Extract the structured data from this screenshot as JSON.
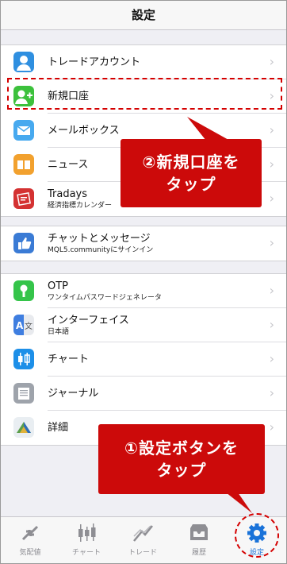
{
  "header": {
    "title": "設定"
  },
  "group1": [
    {
      "label": "トレードアカウント",
      "icon": "person-icon",
      "color": "#2f8fe0"
    },
    {
      "label": "新規口座",
      "icon": "add-person-icon",
      "color": "#3cc13c"
    },
    {
      "label": "メールボックス",
      "icon": "mail-icon",
      "color": "#47a9ef"
    },
    {
      "label": "ニュース",
      "icon": "book-icon",
      "color": "#f2a12e"
    },
    {
      "label": "Tradays",
      "sub": "経済指標カレンダー",
      "icon": "tradays-icon",
      "color": "#d43232"
    }
  ],
  "group2": [
    {
      "label": "チャットとメッセージ",
      "sub": "MQL5.communityにサインイン",
      "icon": "thumb-icon",
      "color": "#3a7bd5"
    }
  ],
  "group3": [
    {
      "label": "OTP",
      "sub": "ワンタイムパスワードジェネレータ",
      "icon": "key-icon",
      "color": "#35c44a"
    },
    {
      "label": "インターフェイス",
      "sub": "日本語",
      "icon": "translate-icon",
      "color": "#3f7ee0"
    },
    {
      "label": "チャート",
      "icon": "candles-icon",
      "color": "#1d8fe8"
    },
    {
      "label": "ジャーナル",
      "icon": "journal-icon",
      "color": "#9ea3ab"
    },
    {
      "label": "詳細",
      "icon": "metatrader-icon",
      "color": "#5a9e4a"
    }
  ],
  "callouts": {
    "new_account": [
      "②新規口座を",
      "タップ"
    ],
    "settings": [
      "①設定ボタンを",
      "タップ"
    ]
  },
  "tabbar": [
    {
      "label": "気配値",
      "icon": "quotes-icon"
    },
    {
      "label": "チャート",
      "icon": "chart-icon"
    },
    {
      "label": "トレード",
      "icon": "trade-icon"
    },
    {
      "label": "履歴",
      "icon": "history-icon"
    },
    {
      "label": "設定",
      "icon": "settings-gear-icon",
      "active": true
    }
  ],
  "colors": {
    "accent": "#1a73d9",
    "callout": "#cc0a0a",
    "chevron": "#c7c7cc"
  }
}
